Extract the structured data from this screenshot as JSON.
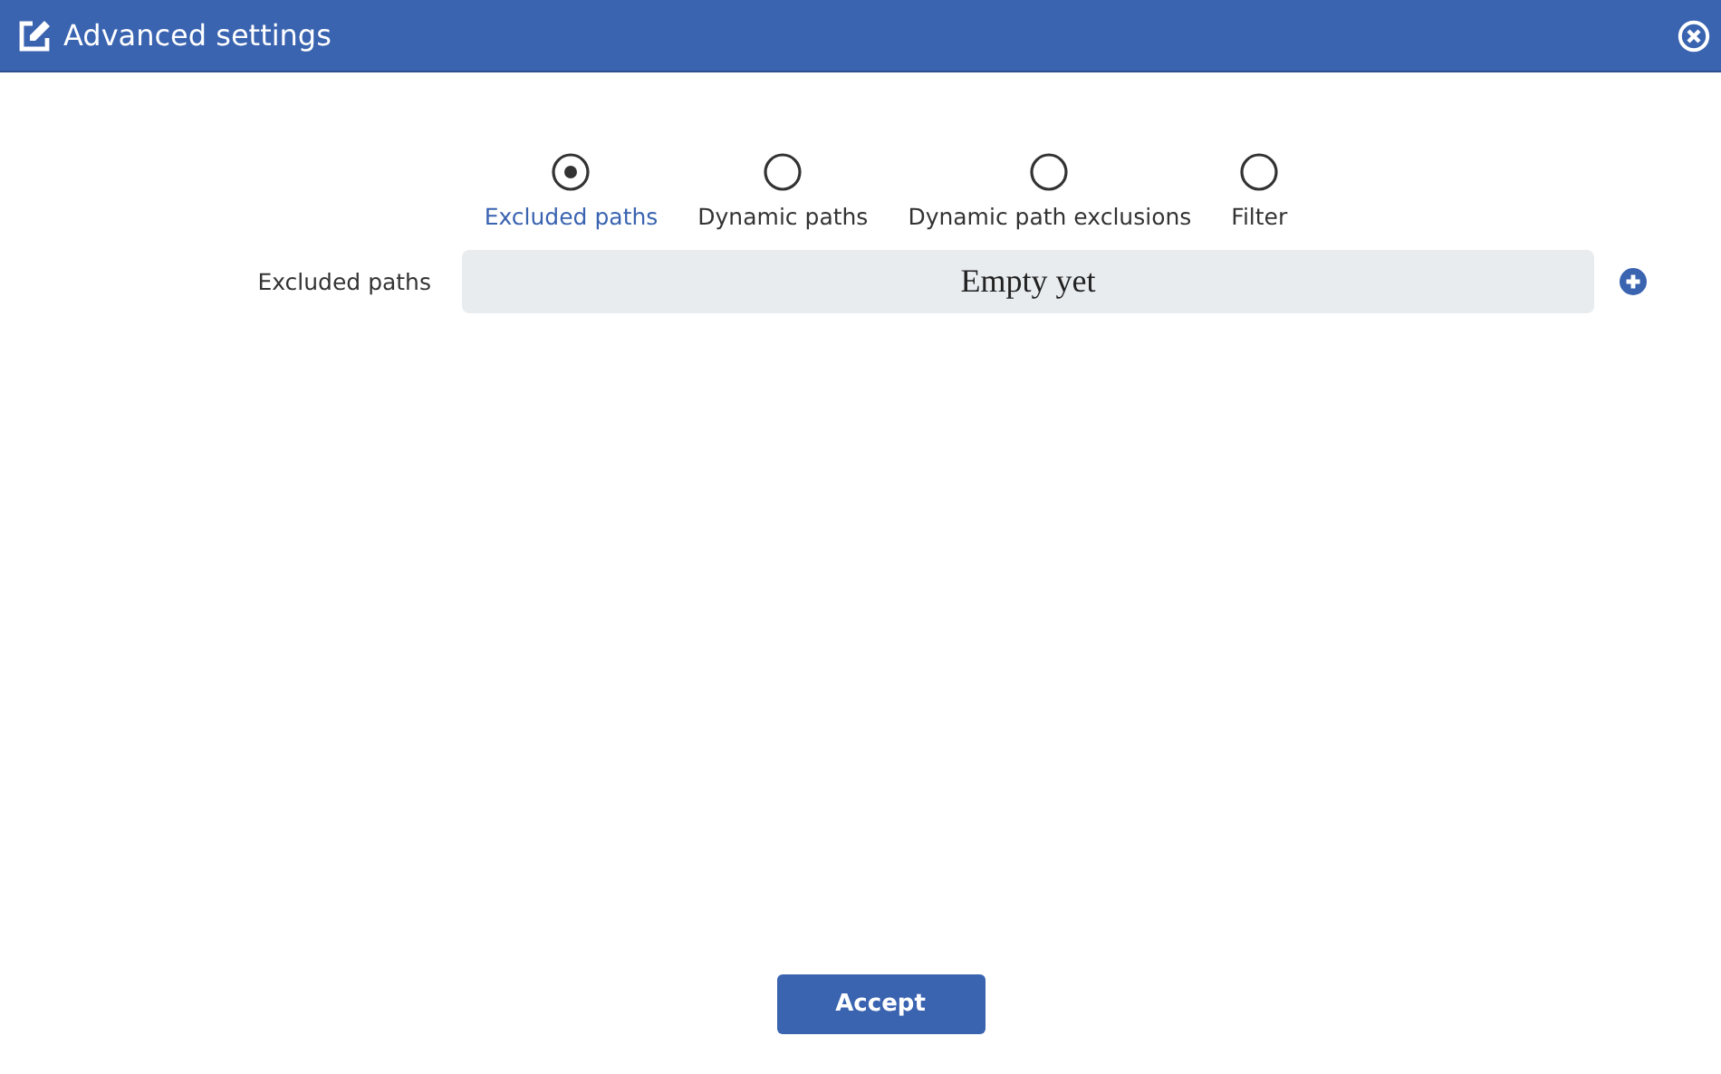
{
  "window": {
    "title": "Advanced settings"
  },
  "tabs": [
    {
      "label": "Excluded paths",
      "selected": true
    },
    {
      "label": "Dynamic paths",
      "selected": false
    },
    {
      "label": "Dynamic path exclusions",
      "selected": false
    },
    {
      "label": "Filter",
      "selected": false
    }
  ],
  "field": {
    "label": "Excluded paths",
    "value": "Empty yet"
  },
  "buttons": [
    "Accept"
  ]
}
